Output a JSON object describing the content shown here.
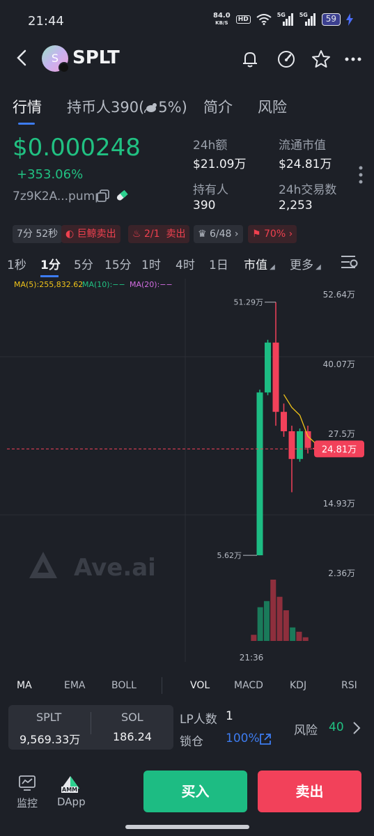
{
  "status_bar": {
    "time": "21:44",
    "net_speed_value": "84.0",
    "net_speed_unit": "KB/S",
    "hd_label": "HD",
    "sim1": "5G",
    "sim2": "5G",
    "battery": "59"
  },
  "header": {
    "token_letter": "S",
    "token_name": "SPLT"
  },
  "tabs": [
    {
      "label": "行情"
    },
    {
      "label": "持币人390(",
      "suffix": "5%)"
    },
    {
      "label": "简介"
    },
    {
      "label": "风险"
    }
  ],
  "price": {
    "value": "$0.000248",
    "change": "+353.06%",
    "address": "7z9K2A...pump"
  },
  "stats": {
    "volume_label": "24h额",
    "volume_value": "$21.09万",
    "mcap_label": "流通市值",
    "mcap_value": "$24.81万",
    "holders_label": "持有人",
    "holders_value": "390",
    "tx_label": "24h交易数",
    "tx_value": "2,253"
  },
  "badges": {
    "age": "7分 52秒",
    "whale": "巨鲸卖出",
    "ratio": "2/1",
    "ratio_action": "卖出",
    "crown": "6/48",
    "runner": "70%"
  },
  "intervals": [
    "1秒",
    "1分",
    "5分",
    "15分",
    "1时",
    "4时",
    "1日"
  ],
  "interval_extra": {
    "mcap": "市值",
    "more": "更多"
  },
  "chart_legend": {
    "ma5": "MA(5):255,832.62",
    "ma10": "MA(10):−−",
    "ma20": "MA(20):−−",
    "ma5_color": "#f0c419",
    "ma10_color": "#21c182",
    "ma20_color": "#d16ce0"
  },
  "chart_data": {
    "type": "candlestick",
    "y_unit": "万",
    "y_ticks": [
      "52.64万",
      "40.07万",
      "27.5万",
      "14.93万",
      "2.36万"
    ],
    "y_tick_values": [
      52.64,
      40.07,
      27.5,
      14.93,
      2.36
    ],
    "x_tick": "21:36",
    "high_label": "51.29万",
    "low_label": "5.62万",
    "current_label": "24.81万",
    "current_value": 24.81,
    "candles": [
      {
        "open": 5.62,
        "close": 35.0,
        "high": 35.5,
        "low": 5.62,
        "dir": "up"
      },
      {
        "open": 35.0,
        "close": 44.0,
        "high": 44.5,
        "low": 34.5,
        "dir": "up"
      },
      {
        "open": 44.0,
        "close": 31.5,
        "high": 51.29,
        "low": 29.0,
        "dir": "down"
      },
      {
        "open": 31.5,
        "close": 28.0,
        "high": 33.0,
        "low": 27.0,
        "dir": "down"
      },
      {
        "open": 28.0,
        "close": 23.0,
        "high": 29.0,
        "low": 17.0,
        "dir": "down"
      },
      {
        "open": 23.0,
        "close": 28.0,
        "high": 28.5,
        "low": 22.5,
        "dir": "up"
      },
      {
        "open": 28.0,
        "close": 25.0,
        "high": 29.0,
        "low": 24.0,
        "dir": "down"
      },
      {
        "open": 25.0,
        "close": 24.81,
        "high": 25.5,
        "low": 24.0,
        "dir": "down"
      }
    ],
    "volumes": [
      {
        "value": 0.1,
        "dir": "down"
      },
      {
        "value": 0.55,
        "dir": "up"
      },
      {
        "value": 0.65,
        "dir": "up"
      },
      {
        "value": 1.0,
        "dir": "down"
      },
      {
        "value": 0.72,
        "dir": "down"
      },
      {
        "value": 0.5,
        "dir": "down"
      },
      {
        "value": 0.22,
        "dir": "up"
      },
      {
        "value": 0.15,
        "dir": "down"
      },
      {
        "value": 0.06,
        "dir": "down"
      }
    ],
    "up_color": "#1dbc83",
    "down_color": "#f2415a",
    "watermark": "Ave.ai"
  },
  "indicators": {
    "main": [
      "MA",
      "EMA",
      "BOLL"
    ],
    "sub": [
      "VOL",
      "MACD",
      "KDJ",
      "RSI"
    ]
  },
  "info": {
    "token_a_label": "SPLT",
    "token_a_value": "9,569.33万",
    "token_b_label": "SOL",
    "token_b_value": "186.24",
    "lp_label": "LP人数",
    "lp_value": "1",
    "lock_label": "锁仓",
    "lock_value": "100%",
    "risk_label": "风险",
    "risk_value": "40"
  },
  "bottom": {
    "monitor": "监控",
    "dapp": "DApp",
    "amm": "AMM",
    "buy": "买入",
    "sell": "卖出"
  }
}
